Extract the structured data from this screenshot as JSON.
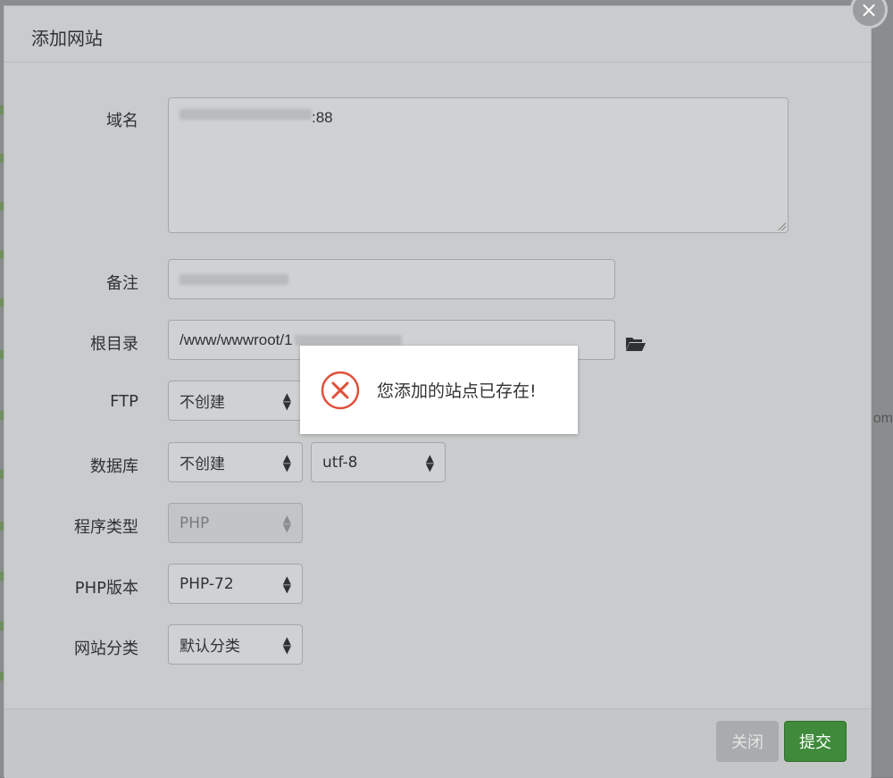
{
  "dialog": {
    "title": "添加网站",
    "close_glyph": "×"
  },
  "form": {
    "domain": {
      "label": "域名",
      "value_suffix": ":88"
    },
    "remark": {
      "label": "备注"
    },
    "root_dir": {
      "label": "根目录",
      "value_prefix": "/www/wwwroot/1"
    },
    "ftp": {
      "label": "FTP",
      "selected": "不创建"
    },
    "database": {
      "label": "数据库",
      "selected": "不创建",
      "charset_selected": "utf-8"
    },
    "program_type": {
      "label": "程序类型",
      "selected": "PHP"
    },
    "php_version": {
      "label": "PHP版本",
      "selected": "PHP-72"
    },
    "site_category": {
      "label": "网站分类",
      "selected": "默认分类"
    }
  },
  "footer": {
    "close_label": "关闭",
    "submit_label": "提交"
  },
  "toast": {
    "message": "您添加的站点已存在!",
    "icon": "error-circle-icon",
    "icon_color": "#e0503a"
  },
  "background": {
    "edge_text": "om"
  },
  "colors": {
    "submit_green": "#3f8a3b",
    "overlay": "#7f8283"
  }
}
